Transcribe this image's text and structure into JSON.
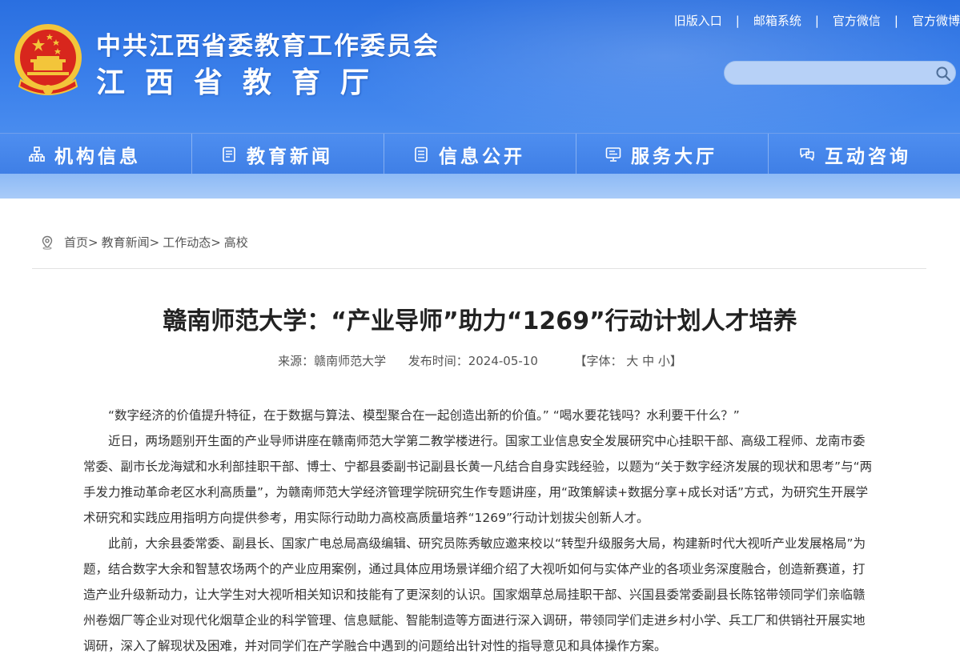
{
  "header": {
    "title_line1": "中共江西省委教育工作委员会",
    "title_line2": "江西省教育厅",
    "top_links": [
      "旧版入口",
      "邮箱系统",
      "官方微信",
      "官方微博"
    ],
    "search_placeholder": ""
  },
  "nav": {
    "items": [
      {
        "label": "机构信息",
        "icon": "org-chart-icon"
      },
      {
        "label": "教育新闻",
        "icon": "news-document-icon"
      },
      {
        "label": "信息公开",
        "icon": "info-list-icon"
      },
      {
        "label": "服务大厅",
        "icon": "monitor-icon"
      },
      {
        "label": "互动咨询",
        "icon": "chat-bubbles-icon"
      }
    ]
  },
  "breadcrumb": {
    "items": [
      "首页",
      "教育新闻",
      "工作动态",
      "高校"
    ],
    "separator": ">"
  },
  "article": {
    "title": "赣南师范大学：“产业导师”助力“1269”行动计划人才培养",
    "source_label": "来源：",
    "source": "赣南师范大学",
    "date_label": "发布时间：",
    "date": "2024-05-10",
    "font_size_label": "【字体：",
    "font_sizes": [
      "大",
      "中",
      "小"
    ],
    "font_size_close": "】",
    "paragraphs": [
      "“数字经济的价值提升特征，在于数据与算法、模型聚合在一起创造出新的价值。” “喝水要花钱吗？水利要干什么？”",
      "近日，两场题别开生面的产业导师讲座在赣南师范大学第二教学楼进行。国家工业信息安全发展研究中心挂职干部、高级工程师、龙南市委常委、副市长龙海斌和水利部挂职干部、博士、宁都县委副书记副县长黄一凡结合自身实践经验，以题为“关于数字经济发展的现状和思考”与“两手发力推动革命老区水利高质量”，为赣南师范大学经济管理学院研究生作专题讲座，用“政策解读+数据分享+成长对话”方式，为研究生开展学术研究和实践应用指明方向提供参考，用实际行动助力高校高质量培养“1269”行动计划拔尖创新人才。",
      "此前，大余县委常委、副县长、国家广电总局高级编辑、研究员陈秀敏应邀来校以“转型升级服务大局，构建新时代大视听产业发展格局”为题，结合数字大余和智慧农场两个的产业应用案例，通过具体应用场景详细介绍了大视听如何与实体产业的各项业务深度融合，创造新赛道，打造产业升级新动力，让大学生对大视听相关知识和技能有了更深刻的认识。国家烟草总局挂职干部、兴国县委常委副县长陈铭带领同学们亲临赣州卷烟厂等企业对现代化烟草企业的科学管理、信息赋能、智能制造等方面进行深入调研，带领同学们走进乡村小学、兵工厂和供销社开展实地调研，深入了解现状及困难，并对同学们在产学融合中遇到的问题给出针对性的指导意见和具体操作方案。"
    ]
  },
  "colors": {
    "header_blue": "#2a6fe0",
    "nav_blue": "#4e8ef0",
    "strip_blue": "#a9cbf8",
    "title_text": "#222222",
    "emblem_red": "#d8261d",
    "emblem_gold": "#f3c53a"
  }
}
